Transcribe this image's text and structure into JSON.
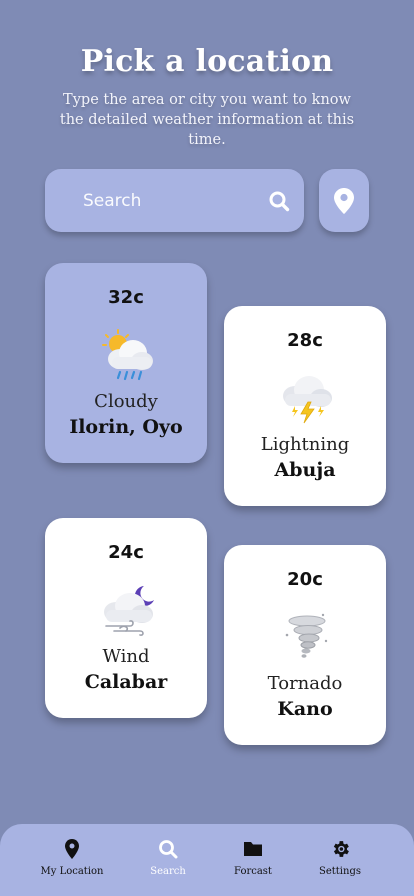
{
  "header": {
    "title": "Pick a location",
    "subtitle": "Type the area or city you want to know the detailed weather information at this time."
  },
  "search": {
    "placeholder": "Search",
    "icon": "search-icon",
    "location_button_icon": "location-pin-icon"
  },
  "cards": [
    {
      "temp": "32c",
      "condition": "Cloudy",
      "city": "Ilorin, Oyo",
      "icon": "cloud-sun-rain-icon",
      "selected": true
    },
    {
      "temp": "28c",
      "condition": "Lightning",
      "city": "Abuja",
      "icon": "cloud-lightning-icon",
      "selected": false
    },
    {
      "temp": "24c",
      "condition": "Wind",
      "city": "Calabar",
      "icon": "cloud-moon-wind-icon",
      "selected": false
    },
    {
      "temp": "20c",
      "condition": "Tornado",
      "city": "Kano",
      "icon": "tornado-icon",
      "selected": false
    }
  ],
  "nav": {
    "items": [
      {
        "label": "My Location",
        "icon": "location-pin-icon"
      },
      {
        "label": "Search",
        "icon": "search-icon",
        "active": true
      },
      {
        "label": "Forcast",
        "icon": "folder-icon"
      },
      {
        "label": "Settings",
        "icon": "gear-icon"
      }
    ]
  },
  "colors": {
    "background": "#7f8bb5",
    "accent": "#a8b3e2",
    "card": "#ffffff"
  }
}
